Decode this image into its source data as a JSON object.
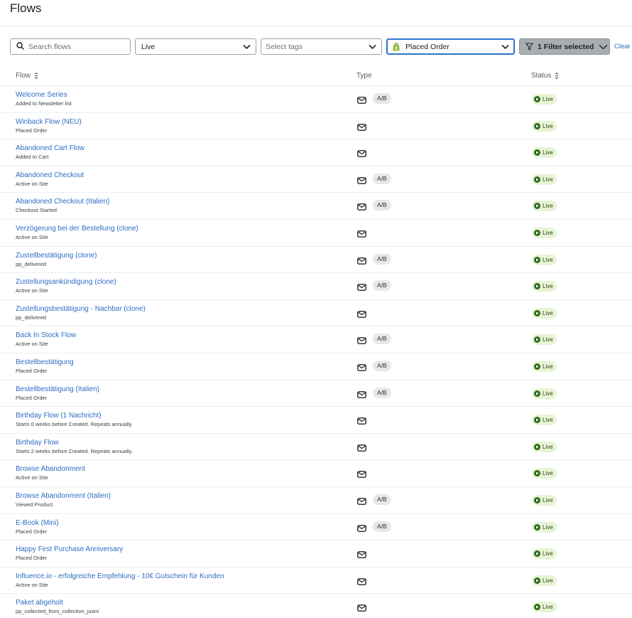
{
  "page": {
    "title": "Flows"
  },
  "filters": {
    "search_placeholder": "Search flows",
    "status_value": "Live",
    "tags_placeholder": "Select tags",
    "trigger_value": "Placed Order",
    "filter_button_label": "1 Filter selected",
    "clear_label": "Clear"
  },
  "table": {
    "headers": {
      "flow": "Flow",
      "type": "Type",
      "status": "Status"
    },
    "rows": [
      {
        "name": "Welcome Series",
        "trigger": "Added to Newsletter list",
        "ab": "A/B",
        "status": "Live"
      },
      {
        "name": "Winback Flow (NEU)",
        "trigger": "Placed Order",
        "ab": null,
        "status": "Live"
      },
      {
        "name": "Abandoned Cart Flow",
        "trigger": "Added to Cart",
        "ab": null,
        "status": "Live"
      },
      {
        "name": "Abandoned Checkout",
        "trigger": "Active on Site",
        "ab": "A/B",
        "status": "Live"
      },
      {
        "name": "Abandoned Checkout (Italien)",
        "trigger": "Checkout Started",
        "ab": "A/B",
        "status": "Live"
      },
      {
        "name": "Verzögerung bei der Bestellung (clone)",
        "trigger": "Active on Site",
        "ab": null,
        "status": "Live"
      },
      {
        "name": "Zustellbestätigung (clone)",
        "trigger": "pp_delivered",
        "ab": "A/B",
        "status": "Live"
      },
      {
        "name": "Zustellungsankündigung (clone)",
        "trigger": "Active on Site",
        "ab": "A/B",
        "status": "Live"
      },
      {
        "name": "Zustellungsbestätigung - Nachbar (clone)",
        "trigger": "pp_delivered",
        "ab": null,
        "status": "Live"
      },
      {
        "name": "Back In Stock Flow",
        "trigger": "Active on Site",
        "ab": "A/B",
        "status": "Live"
      },
      {
        "name": "Bestellbestätigung",
        "trigger": "Placed Order",
        "ab": "A/B",
        "status": "Live"
      },
      {
        "name": "Bestellbestätigung (Italien)",
        "trigger": "Placed Order",
        "ab": "A/B",
        "status": "Live"
      },
      {
        "name": "Birthday Flow (1 Nachricht)",
        "trigger": "Starts 0 weeks before Created. Repeats annually.",
        "ab": null,
        "status": "Live"
      },
      {
        "name": "Birthday Flow",
        "trigger": "Starts 2 weeks before Created. Repeats annually.",
        "ab": null,
        "status": "Live"
      },
      {
        "name": "Browse Abandonment",
        "trigger": "Active on Site",
        "ab": null,
        "status": "Live"
      },
      {
        "name": "Browse Abandonment (Italien)",
        "trigger": "Viewed Product",
        "ab": "A/B",
        "status": "Live"
      },
      {
        "name": "E-Book (Mini)",
        "trigger": "Placed Order",
        "ab": "A/B",
        "status": "Live"
      },
      {
        "name": "Happy First Purchase Anniversary",
        "trigger": "Placed Order",
        "ab": null,
        "status": "Live"
      },
      {
        "name": "Influence.io - erfolgreiche Empfehlung - 10€ Gutschein für Kunden",
        "trigger": "Active on Site",
        "ab": null,
        "status": "Live"
      },
      {
        "name": "Paket abgeholt",
        "trigger": "pp_collected_from_collection_point",
        "ab": null,
        "status": "Live"
      }
    ]
  },
  "colors": {
    "link": "#2d6cc4",
    "live_badge_bg": "#e7f4d5",
    "live_dot": "#2f6a1e",
    "ab_badge_bg": "#e6e7e9",
    "focus_border": "#2f73c7",
    "filter_button_bg": "#a9adb3"
  },
  "icons": {
    "search": "search-icon",
    "chevron": "chevron-down-icon",
    "shopify": "shopify-bag-icon",
    "filter": "funnel-icon",
    "sort": "sort-icon",
    "email": "email-icon",
    "live": "play-icon"
  }
}
